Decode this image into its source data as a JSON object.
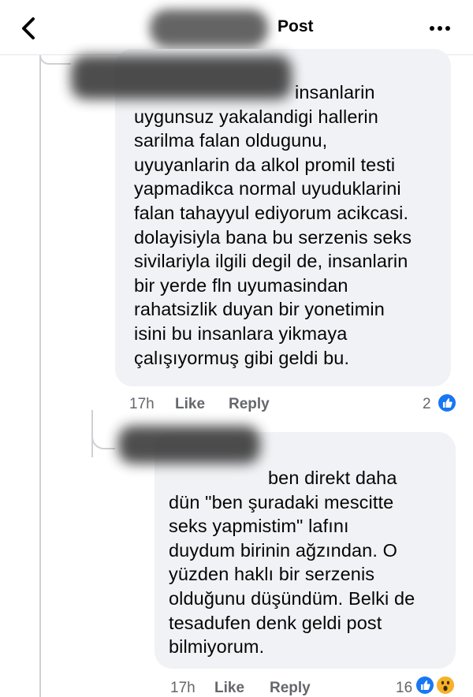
{
  "header": {
    "title": "Post",
    "back_icon": "chevron-left-icon",
    "more_icon": "more-horizontal-icon"
  },
  "comments": [
    {
      "text_lines": [
        "insanlarin",
        "uygunsuz yakalandigi hallerin",
        "sarilma falan oldugunu,",
        "uyuyanlarin da alkol promil testi",
        "yapmadikca normal uyuduklarini",
        "falan tahayyul ediyorum acikcasi.",
        "dolayisiyla bana bu serzenis seks",
        "sivilariyla ilgili degil de, insanlarin",
        "bir yerde fln uyumasindan",
        "rahatsizlik duyan bir yonetimin",
        "isini bu insanlara yikmaya",
        "çalışıyormuş gibi geldi bu."
      ],
      "time": "17h",
      "like_label": "Like",
      "reply_label": "Reply",
      "reaction_count": "2",
      "reactions": [
        "like-icon"
      ]
    },
    {
      "text_lines": [
        "ben direkt daha",
        "dün \"ben şuradaki mescitte",
        "seks yapmistim\" lafını",
        "duydum birinin ağzından. O",
        "yüzden haklı bir serzenis",
        "olduğunu düşündüm. Belki de",
        "tesadufen denk geldi post",
        "bilmiyorum."
      ],
      "time": "17h",
      "like_label": "Like",
      "reply_label": "Reply",
      "reaction_count": "16",
      "reactions": [
        "like-icon",
        "wow-icon"
      ]
    }
  ],
  "colors": {
    "bubble": "#f0f2f5",
    "meta_text": "#65676b",
    "like_blue": "#1877f2",
    "wow_yellow": "#f7b125"
  }
}
